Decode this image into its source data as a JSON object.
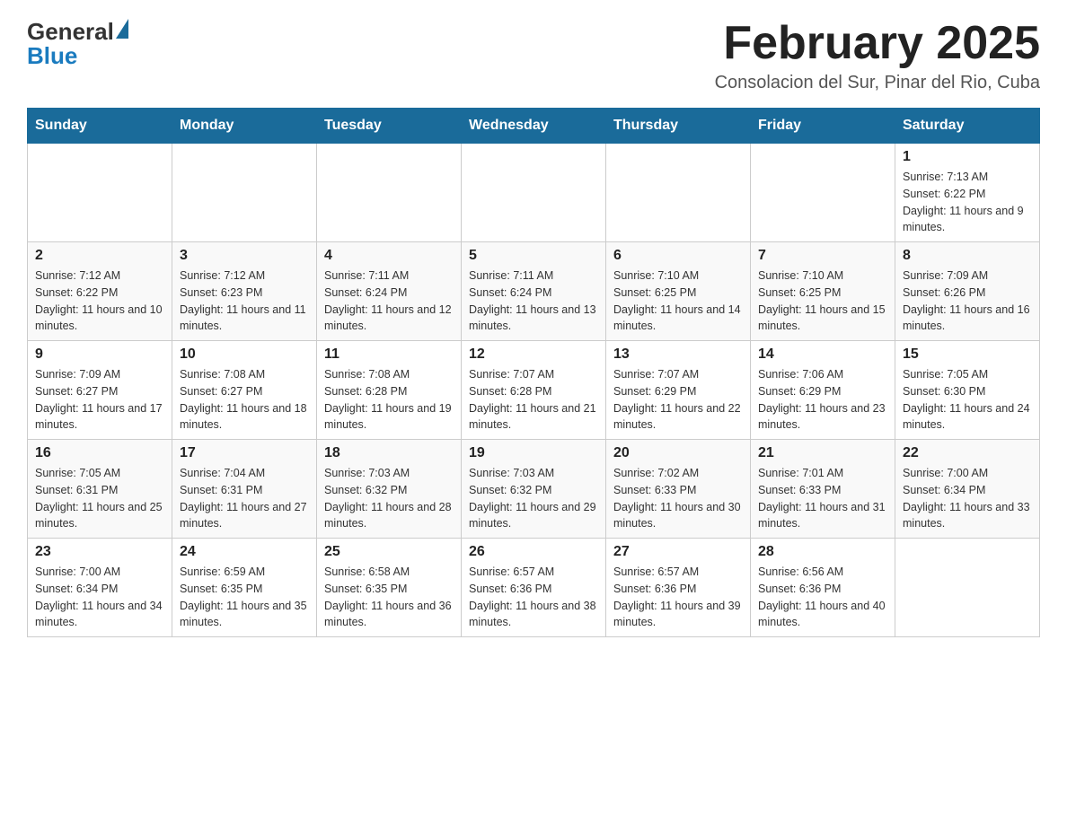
{
  "header": {
    "logo_general": "General",
    "logo_blue": "Blue",
    "month_title": "February 2025",
    "subtitle": "Consolacion del Sur, Pinar del Rio, Cuba"
  },
  "calendar": {
    "weekdays": [
      "Sunday",
      "Monday",
      "Tuesday",
      "Wednesday",
      "Thursday",
      "Friday",
      "Saturday"
    ],
    "weeks": [
      [
        {
          "day": "",
          "info": ""
        },
        {
          "day": "",
          "info": ""
        },
        {
          "day": "",
          "info": ""
        },
        {
          "day": "",
          "info": ""
        },
        {
          "day": "",
          "info": ""
        },
        {
          "day": "",
          "info": ""
        },
        {
          "day": "1",
          "info": "Sunrise: 7:13 AM\nSunset: 6:22 PM\nDaylight: 11 hours and 9 minutes."
        }
      ],
      [
        {
          "day": "2",
          "info": "Sunrise: 7:12 AM\nSunset: 6:22 PM\nDaylight: 11 hours and 10 minutes."
        },
        {
          "day": "3",
          "info": "Sunrise: 7:12 AM\nSunset: 6:23 PM\nDaylight: 11 hours and 11 minutes."
        },
        {
          "day": "4",
          "info": "Sunrise: 7:11 AM\nSunset: 6:24 PM\nDaylight: 11 hours and 12 minutes."
        },
        {
          "day": "5",
          "info": "Sunrise: 7:11 AM\nSunset: 6:24 PM\nDaylight: 11 hours and 13 minutes."
        },
        {
          "day": "6",
          "info": "Sunrise: 7:10 AM\nSunset: 6:25 PM\nDaylight: 11 hours and 14 minutes."
        },
        {
          "day": "7",
          "info": "Sunrise: 7:10 AM\nSunset: 6:25 PM\nDaylight: 11 hours and 15 minutes."
        },
        {
          "day": "8",
          "info": "Sunrise: 7:09 AM\nSunset: 6:26 PM\nDaylight: 11 hours and 16 minutes."
        }
      ],
      [
        {
          "day": "9",
          "info": "Sunrise: 7:09 AM\nSunset: 6:27 PM\nDaylight: 11 hours and 17 minutes."
        },
        {
          "day": "10",
          "info": "Sunrise: 7:08 AM\nSunset: 6:27 PM\nDaylight: 11 hours and 18 minutes."
        },
        {
          "day": "11",
          "info": "Sunrise: 7:08 AM\nSunset: 6:28 PM\nDaylight: 11 hours and 19 minutes."
        },
        {
          "day": "12",
          "info": "Sunrise: 7:07 AM\nSunset: 6:28 PM\nDaylight: 11 hours and 21 minutes."
        },
        {
          "day": "13",
          "info": "Sunrise: 7:07 AM\nSunset: 6:29 PM\nDaylight: 11 hours and 22 minutes."
        },
        {
          "day": "14",
          "info": "Sunrise: 7:06 AM\nSunset: 6:29 PM\nDaylight: 11 hours and 23 minutes."
        },
        {
          "day": "15",
          "info": "Sunrise: 7:05 AM\nSunset: 6:30 PM\nDaylight: 11 hours and 24 minutes."
        }
      ],
      [
        {
          "day": "16",
          "info": "Sunrise: 7:05 AM\nSunset: 6:31 PM\nDaylight: 11 hours and 25 minutes."
        },
        {
          "day": "17",
          "info": "Sunrise: 7:04 AM\nSunset: 6:31 PM\nDaylight: 11 hours and 27 minutes."
        },
        {
          "day": "18",
          "info": "Sunrise: 7:03 AM\nSunset: 6:32 PM\nDaylight: 11 hours and 28 minutes."
        },
        {
          "day": "19",
          "info": "Sunrise: 7:03 AM\nSunset: 6:32 PM\nDaylight: 11 hours and 29 minutes."
        },
        {
          "day": "20",
          "info": "Sunrise: 7:02 AM\nSunset: 6:33 PM\nDaylight: 11 hours and 30 minutes."
        },
        {
          "day": "21",
          "info": "Sunrise: 7:01 AM\nSunset: 6:33 PM\nDaylight: 11 hours and 31 minutes."
        },
        {
          "day": "22",
          "info": "Sunrise: 7:00 AM\nSunset: 6:34 PM\nDaylight: 11 hours and 33 minutes."
        }
      ],
      [
        {
          "day": "23",
          "info": "Sunrise: 7:00 AM\nSunset: 6:34 PM\nDaylight: 11 hours and 34 minutes."
        },
        {
          "day": "24",
          "info": "Sunrise: 6:59 AM\nSunset: 6:35 PM\nDaylight: 11 hours and 35 minutes."
        },
        {
          "day": "25",
          "info": "Sunrise: 6:58 AM\nSunset: 6:35 PM\nDaylight: 11 hours and 36 minutes."
        },
        {
          "day": "26",
          "info": "Sunrise: 6:57 AM\nSunset: 6:36 PM\nDaylight: 11 hours and 38 minutes."
        },
        {
          "day": "27",
          "info": "Sunrise: 6:57 AM\nSunset: 6:36 PM\nDaylight: 11 hours and 39 minutes."
        },
        {
          "day": "28",
          "info": "Sunrise: 6:56 AM\nSunset: 6:36 PM\nDaylight: 11 hours and 40 minutes."
        },
        {
          "day": "",
          "info": ""
        }
      ]
    ]
  }
}
